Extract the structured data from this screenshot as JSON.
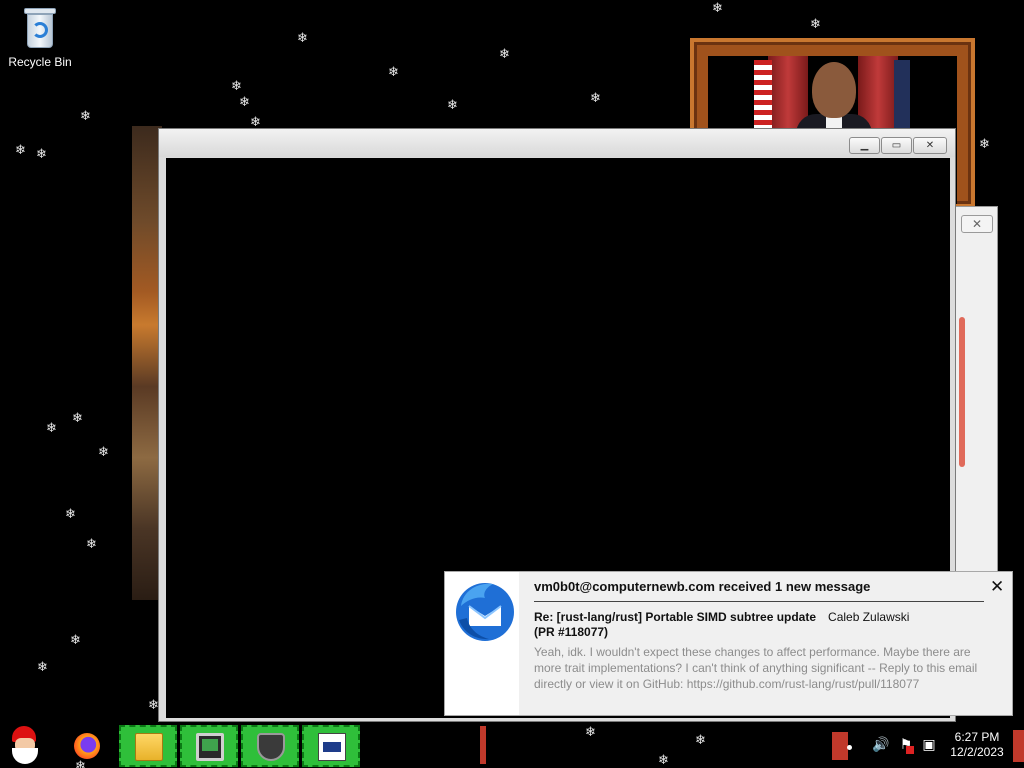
{
  "desktop": {
    "icons": [
      {
        "label": "Recycle Bin",
        "icon": "recycle-bin-icon"
      }
    ]
  },
  "main_window": {
    "buttons": {
      "minimize": "▁",
      "maximize": "▭",
      "close": "✕"
    }
  },
  "side_window": {
    "close_label": "✕"
  },
  "notification": {
    "app_icon": "thunderbird-icon",
    "title": "vm0b0t@computernewb.com received 1 new message",
    "close_label": "✕",
    "subject": "Re: [rust-lang/rust] Portable SIMD subtree update",
    "subject_suffix": "(PR #118077)",
    "sender": "Caleb Zulawski",
    "body": "Yeah, idk. I wouldn't expect these changes to affect performance. Maybe there are more trait implementations? I can't think of anything significant -- Reply to this email directly or view it on GitHub: https://github.com/rust-lang/rust/pull/118077",
    "accent_color": "#1f6fd6"
  },
  "taskbar": {
    "start_icon": "santa-start-icon",
    "pinned": [
      {
        "icon": "firefox-icon"
      }
    ],
    "tasks": [
      {
        "icon": "file-explorer-icon"
      },
      {
        "icon": "computer-monitor-icon"
      },
      {
        "icon": "world-of-tanks-icon"
      },
      {
        "icon": "document-window-icon"
      }
    ],
    "tray": {
      "icons": [
        "volume-icon",
        "action-center-flag-icon",
        "network-icon"
      ],
      "time": "6:27 PM",
      "date": "12/2/2023"
    },
    "strip_color": "#2fbf3a",
    "alert_color": "#c0392b"
  }
}
